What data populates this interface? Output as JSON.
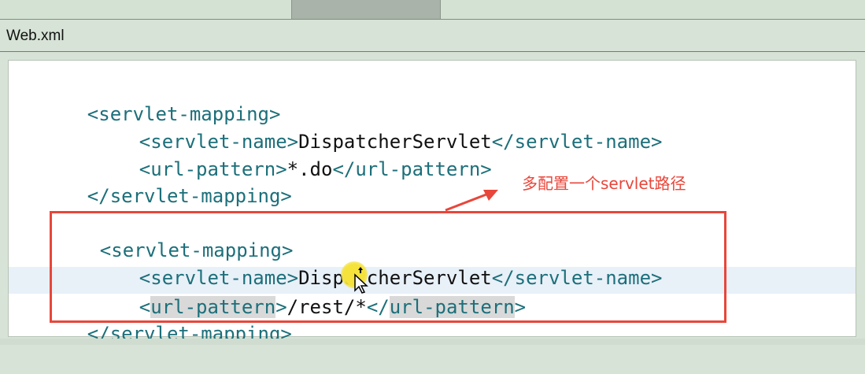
{
  "window": {
    "title": "Web.xml"
  },
  "code": {
    "block1": {
      "open": "<servlet-mapping>",
      "name_open": "<servlet-name>",
      "name_value": "DispatcherServlet",
      "name_close": "</servlet-name>",
      "pattern_open": "<url-pattern>",
      "pattern_value": "*.do",
      "pattern_close": "</url-pattern>",
      "close": "</servlet-mapping>"
    },
    "block2": {
      "open": "<servlet-mapping>",
      "name_open": "<servlet-name>",
      "name_value": "DispatcherServlet",
      "name_close": "</servlet-name>",
      "pattern_lt": "<",
      "pattern_tagname": "url-pattern",
      "pattern_gt": ">",
      "pattern_value": "/rest/*",
      "pattern_close_lt": "</",
      "pattern_close_tagname": "url-pattern",
      "pattern_close_gt": ">",
      "close": "</servlet-mapping>"
    }
  },
  "annotation": {
    "text": "多配置一个servlet路径"
  },
  "colors": {
    "tag": "#1c6f7a",
    "annotation": "#e8463a",
    "highlight_line": "#e8f0f8"
  },
  "icons": {
    "cursor": "move-cursor-icon"
  }
}
